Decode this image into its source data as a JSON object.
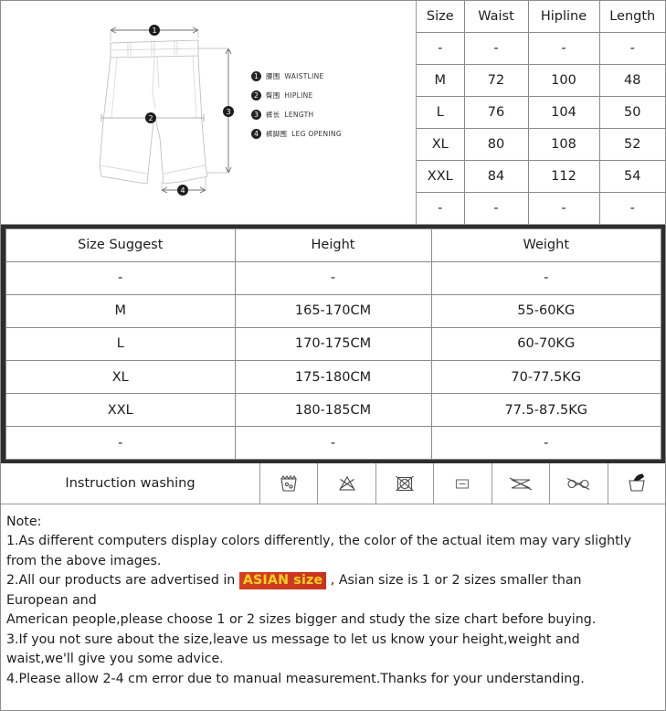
{
  "diagram": {
    "alt": "mens shorts technical drawing with measurement callouts",
    "callouts": [
      "1",
      "2",
      "3",
      "4"
    ],
    "legend": [
      {
        "num": "1",
        "cn": "腰围",
        "en": "WAISTLINE"
      },
      {
        "num": "2",
        "cn": "臀围",
        "en": "HIPLINE"
      },
      {
        "num": "3",
        "cn": "裤长",
        "en": "LENGTH"
      },
      {
        "num": "4",
        "cn": "裤脚围",
        "en": "LEG OPENING"
      }
    ]
  },
  "size_table": {
    "headers": [
      "Size",
      "Waist",
      "Hipline",
      "Length"
    ],
    "rows": [
      [
        "-",
        "-",
        "-",
        "-"
      ],
      [
        "M",
        "72",
        "100",
        "48"
      ],
      [
        "L",
        "76",
        "104",
        "50"
      ],
      [
        "XL",
        "80",
        "108",
        "52"
      ],
      [
        "XXL",
        "84",
        "112",
        "54"
      ],
      [
        "-",
        "-",
        "-",
        "-"
      ]
    ]
  },
  "suggest_table": {
    "headers": [
      "Size Suggest",
      "Height",
      "Weight"
    ],
    "rows": [
      [
        "-",
        "-",
        "-"
      ],
      [
        "M",
        "165-170CM",
        "55-60KG"
      ],
      [
        "L",
        "170-175CM",
        "60-70KG"
      ],
      [
        "XL",
        "175-180CM",
        "70-77.5KG"
      ],
      [
        "XXL",
        "180-185CM",
        "77.5-87.5KG"
      ],
      [
        "-",
        "-",
        "-"
      ]
    ]
  },
  "washing": {
    "label": "Instruction washing",
    "icons": [
      "machine-wash-icon",
      "do-not-bleach-icon",
      "do-not-tumble-dry-icon",
      "iron-low-heat-icon",
      "do-not-wring-icon",
      "do-not-dry-clean-icon",
      "hand-wash-icon"
    ]
  },
  "notes": {
    "heading": "Note:",
    "line1a": "1.As different computers display colors differently, the color of the actual item may vary slightly",
    "line1b": "from the above images.",
    "line2_pre": "2.All our products are advertised in ",
    "line2_highlight": "ASIAN size",
    "line2_post": " , Asian size is 1 or 2 sizes smaller than",
    "line2b": "European and",
    "line2c": "American people,please choose 1 or 2 sizes bigger and study the size chart before buying.",
    "line3a": "3.If you not sure about the size,leave us message to let us know your height,weight and",
    "line3b": "waist,we'll give you some advice.",
    "line4": "4.Please allow 2-4 cm error due to manual measurement.Thanks for your understanding."
  },
  "colors": {
    "frame_dark": "#2e2e2e",
    "grid_line": "#8a8a8a",
    "highlight_bg": "#cf3b20",
    "highlight_text": "#ffd21e",
    "text": "#1d1d1d"
  }
}
